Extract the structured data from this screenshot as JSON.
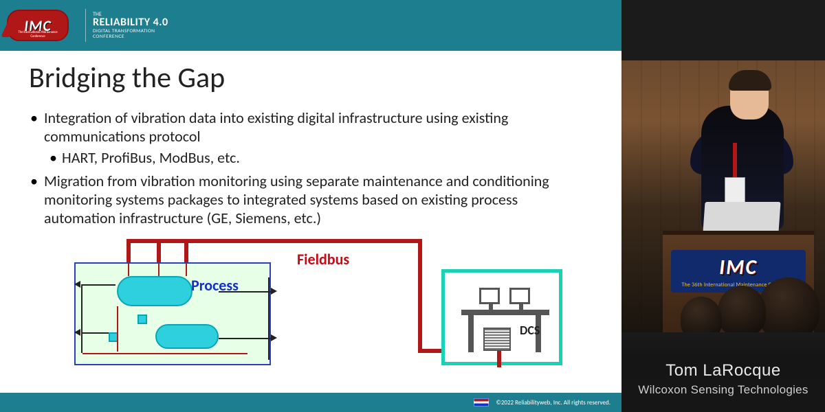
{
  "header": {
    "imc_logo_text": "IMC",
    "imc_logo_sub": "The International Maintenance Conference",
    "conf_the": "THE",
    "conf_main": "RELIABILITY 4.0",
    "conf_sub1": "DIGITAL TRANSFORMATION",
    "conf_sub2": "CONFERENCE"
  },
  "slide": {
    "title": "Bridging the Gap",
    "bullets": [
      {
        "text": "Integration of vibration data into existing digital infrastructure using existing communications protocol",
        "sub": [
          "HART, ProfiBus, ModBus, etc."
        ]
      },
      {
        "text": "Migration from vibration monitoring using separate maintenance and conditioning monitoring systems packages to integrated systems based on existing process automation infrastructure (GE, Siemens, etc.)",
        "sub": []
      }
    ],
    "diagram": {
      "process_label": "Process",
      "fieldbus_label": "Fieldbus",
      "dcs_label": "DCS"
    },
    "footer": "©2022 Reliabilityweb, Inc. All rights reserved."
  },
  "podium": {
    "logo": "IMC",
    "sub": "The 36th International Maintenance Conference"
  },
  "lower_third": {
    "name": "Tom LaRocque",
    "org": "Wilcoxon Sensing Technologies"
  }
}
